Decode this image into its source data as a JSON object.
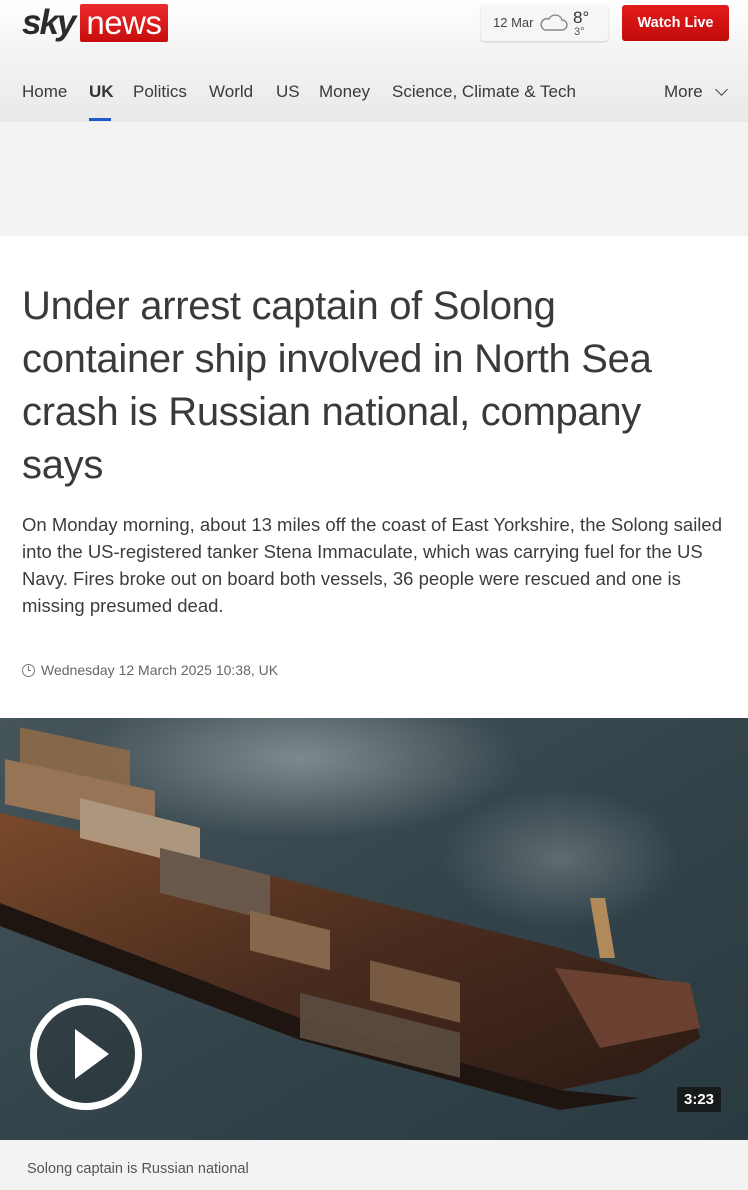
{
  "brand": {
    "sky": "sky",
    "news": "news",
    "accent": "#d91c1c"
  },
  "weather": {
    "date": "12 Mar",
    "icon": "cloud-icon",
    "high": "8°",
    "low": "3°"
  },
  "watch_live": "Watch Live",
  "nav": {
    "items": [
      "Home",
      "UK",
      "Politics",
      "World",
      "US",
      "Money",
      "Science, Climate & Tech"
    ],
    "active": "UK",
    "more": "More",
    "active_color": "#2258c8"
  },
  "article": {
    "headline": "Under arrest captain of Solong container ship involved in North Sea crash is Russian national, company says",
    "standfirst": "On Monday morning, about 13 miles off the coast of East Yorkshire, the Solong sailed into the US-registered tanker Stena Immaculate, which was carrying fuel for the US Navy. Fires broke out on board both vessels, 36 people were rescued and one is missing presumed dead.",
    "timestamp": "Wednesday 12 March 2025 10:38, UK"
  },
  "video": {
    "duration": "3:23",
    "caption": "Solong captain is Russian national"
  }
}
